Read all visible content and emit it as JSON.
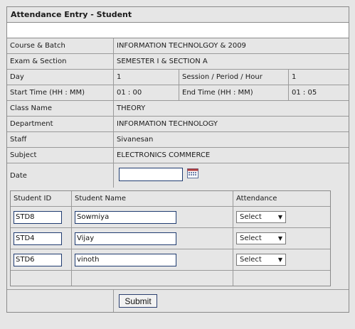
{
  "form": {
    "title": "Attendance Entry - Student",
    "fields": {
      "course_label": "Course & Batch",
      "course_value": "INFORMATION TECHNOLGOY & 2009",
      "exam_label": "Exam & Section",
      "exam_value": "SEMESTER I & SECTION A",
      "day_label": "Day",
      "day_value": "1",
      "session_label": "Session / Period / Hour",
      "session_value": "1",
      "start_label": "Start Time (HH : MM)",
      "start_value": "01 : 00",
      "end_label": "End Time (HH : MM)",
      "end_value": "01 : 05",
      "class_label": "Class Name",
      "class_value": "THEORY",
      "dept_label": "Department",
      "dept_value": "INFORMATION TECHNOLOGY",
      "staff_label": "Staff",
      "staff_value": "Sivanesan",
      "subject_label": "Subject",
      "subject_value": "ELECTRONICS COMMERCE",
      "date_label": "Date",
      "date_value": ""
    },
    "table": {
      "headers": [
        "Student ID",
        "Student Name",
        "Attendance"
      ],
      "rows": [
        {
          "id": "STD8",
          "name": "Sowmiya",
          "attendance": "Select"
        },
        {
          "id": "STD4",
          "name": "Vijay",
          "attendance": "Select"
        },
        {
          "id": "STD6",
          "name": "vinoth",
          "attendance": "Select"
        }
      ]
    },
    "submit_label": "Submit"
  },
  "icons": {
    "date_picker": "calendar-icon",
    "dropdown": "chevron-down-icon"
  }
}
